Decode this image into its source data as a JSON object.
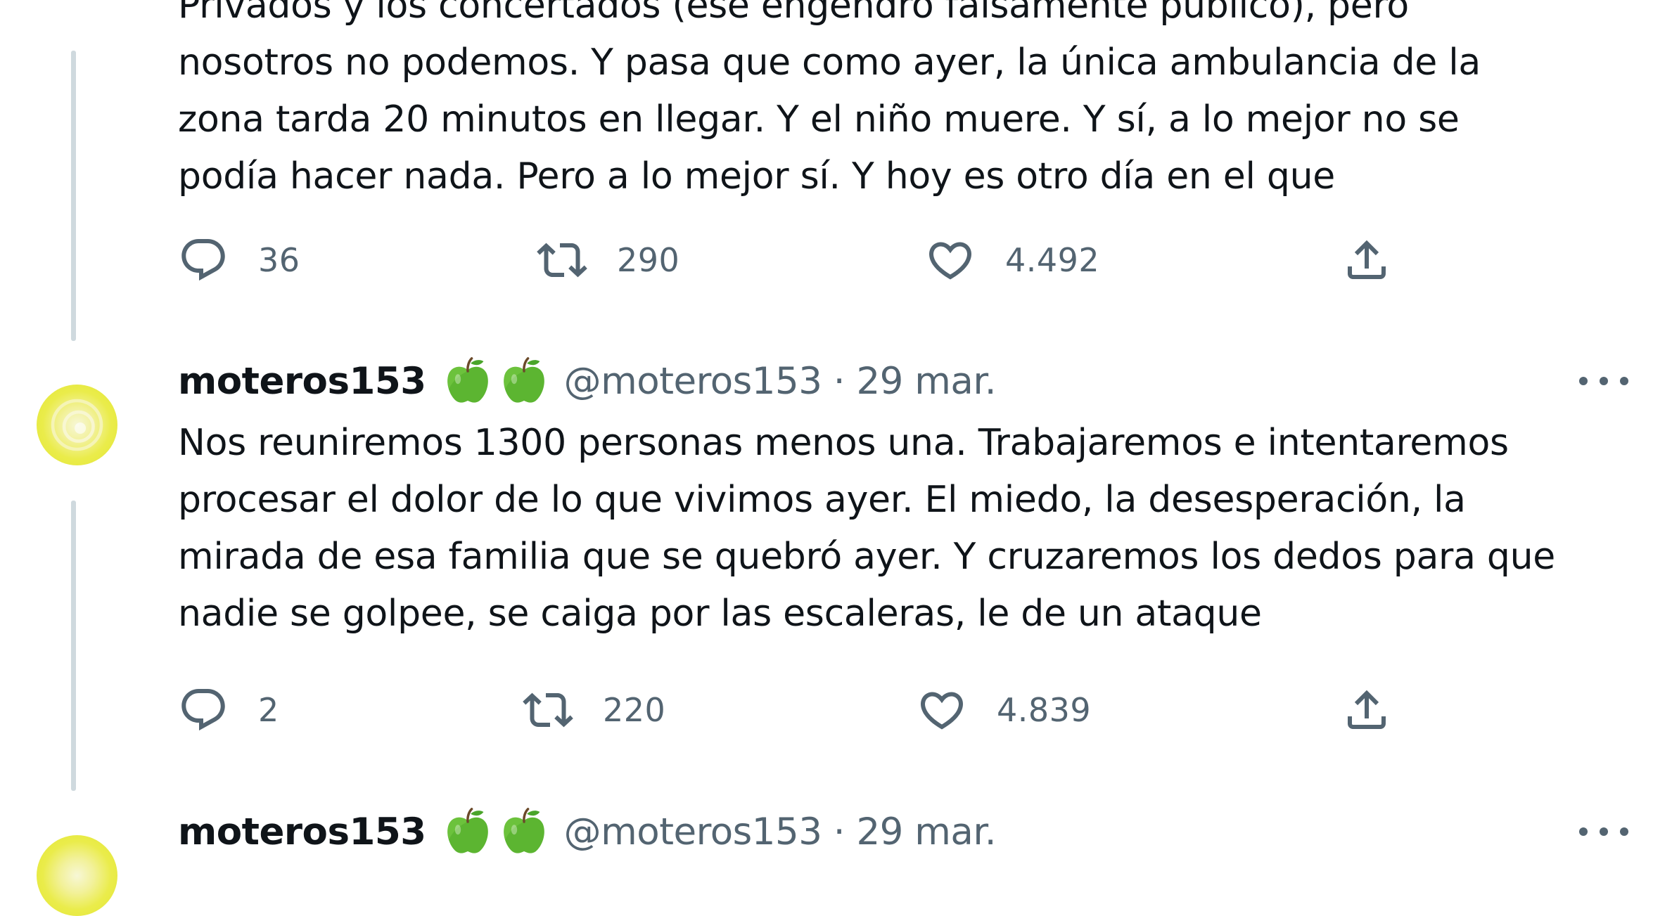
{
  "tweets": [
    {
      "text_lines": [
        "Privados y los concertados (ese engendro falsamente público), pero",
        "nosotros no podemos. Y pasa que como ayer, la única ambulancia de la",
        "zona tarda 20 minutos en llegar. Y el niño muere. Y sí, a lo mejor no se",
        "podía hacer nada. Pero a lo mejor sí. Y hoy es otro día en el que"
      ],
      "replies": "36",
      "retweets": "290",
      "likes": "4.492"
    },
    {
      "username": "moteros153",
      "badges": [
        "green-apple-icon",
        "green-apple-icon"
      ],
      "handle_date": "@moteros153 · 29 mar.",
      "text_lines": [
        "Nos reuniremos 1300 personas menos una. Trabajaremos e intentaremos",
        "procesar el dolor de lo que vivimos ayer. El miedo, la desesperación, la",
        "mirada de esa familia que se quebró ayer. Y cruzaremos los dedos para que",
        "nadie se golpee, se caiga por las escaleras, le de un ataque"
      ],
      "replies": "2",
      "retweets": "220",
      "likes": "4.839"
    },
    {
      "username": "moteros153",
      "badges": [
        "green-apple-icon",
        "green-apple-icon"
      ],
      "handle_date": "@moteros153 · 29 mar."
    }
  ],
  "icons": {
    "reply": "reply-icon",
    "retweet": "retweet-icon",
    "like": "like-icon",
    "share": "share-icon",
    "more": "more-icon"
  },
  "colors": {
    "text": "#0f1419",
    "secondary": "#536471",
    "thread_line": "#cfd9de",
    "avatar": "#e8ea3c",
    "apple": "#5cb531"
  }
}
